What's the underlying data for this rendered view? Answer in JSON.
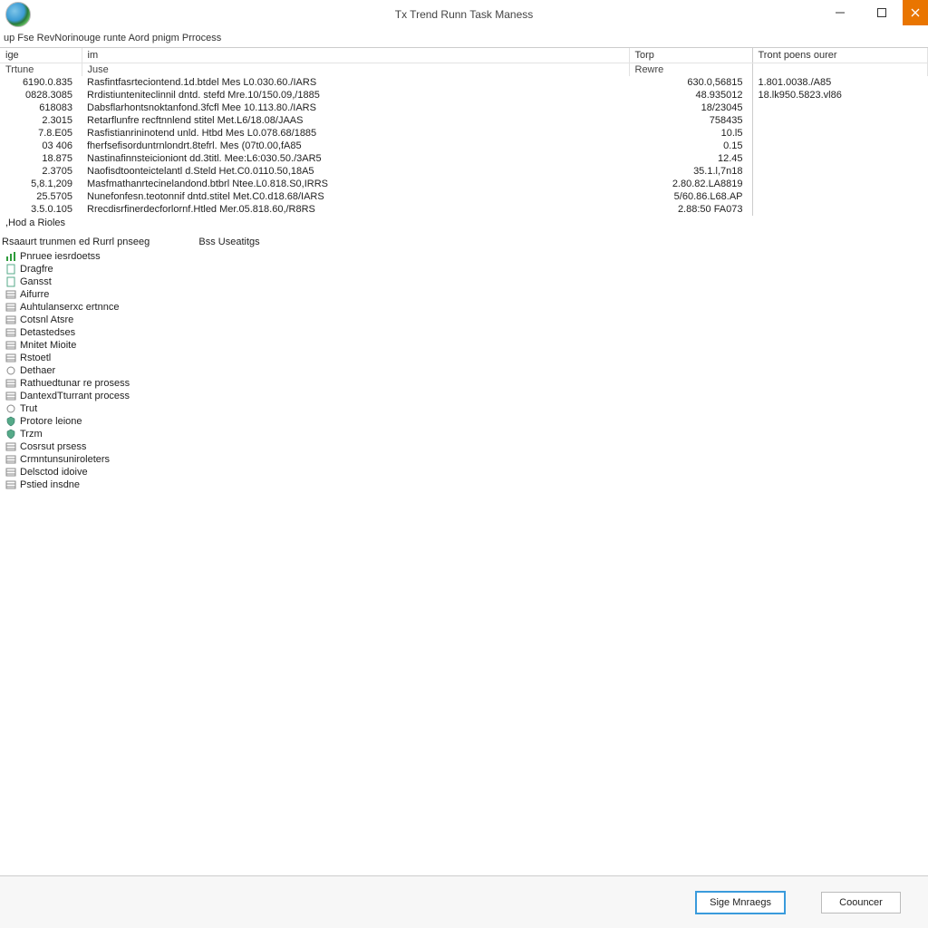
{
  "window": {
    "title": "Tx Trend Runn Task Maness"
  },
  "menubar": "up  Fse RevNorinouge runte Aord pnigm Prrocess",
  "columns": {
    "c0": "ige",
    "c1": "im",
    "c2": "Torp",
    "c3": "Tront poens ourer",
    "s0": "Trtune",
    "s1": "Juse",
    "s2": "Rewre"
  },
  "rows": [
    {
      "a": "6190.0.835",
      "b": "Rasfintfasrteciontend.1d.btdel Mes L0.030.60./IARS",
      "c": "630.0,56815",
      "d": "1.801.0038./A85"
    },
    {
      "a": "0828.3085",
      "b": "Rrdistiunteniteclinnil dntd. stefd Mre.10/150.09,/1885",
      "c": "48.935012",
      "d": "18.lk950.5823.vl86"
    },
    {
      "a": "618083",
      "b": "Dabsflarhontsnoktanfond.3fcfl Mee 10.113.80./IARS",
      "c": "18/23045",
      "d": ""
    },
    {
      "a": "2.3015",
      "b": "Retarflunfre recftnnlend stitel Met.L6/18.08/JAAS",
      "c": "758435",
      "d": ""
    },
    {
      "a": "7.8.E05",
      "b": "Rasfistianrininotend unld. Htbd Mes L0.078.68/1885",
      "c": "10.l5",
      "d": ""
    },
    {
      "a": "03 406",
      "b": "fherfsefisorduntrnlondrt.8tefrl. Mes (07t0.00,fA85",
      "c": "0.15",
      "d": ""
    },
    {
      "a": "18.875",
      "b": "Nastinafinnsteicioniont dd.3titl. Mee:L6:030.50./3AR5",
      "c": "12.45",
      "d": ""
    },
    {
      "a": "2.3705",
      "b": "Naofisdtoonteictelantl d.Steld Het.C0.0110.50,18A5",
      "c": "35.1.l,7n18",
      "d": ""
    },
    {
      "a": "5,8.1,209",
      "b": "Masfmathanrtecinelandond.btbrl Ntee.L0.818.S0,IRRS",
      "c": "2.80.82.LA8819",
      "d": ""
    },
    {
      "a": "25.5705",
      "b": "Nunefonfesn.teotonnif dntd.stitel Met.C0.d18.68/IARS",
      "c": "5/60.86.L68.AP",
      "d": ""
    },
    {
      "a": "3.5.0.105",
      "b": "Rrecdisrfinerdecforlornf.Htled Mer.05.818.60,/R8RS",
      "c": "2.88:50 FA073",
      "d": ""
    }
  ],
  "had": ",Hod a Rioles",
  "lower_head": {
    "left": "Rsaaurt trunmen ed Rurrl pnseeg",
    "right": "Bss Useatitgs"
  },
  "tree": [
    {
      "icon": "chart",
      "label": "Pnruee iesrdoetss"
    },
    {
      "icon": "page",
      "label": "Dragfre"
    },
    {
      "icon": "page",
      "label": "Gansst"
    },
    {
      "icon": "list",
      "label": "Aifurre"
    },
    {
      "icon": "list",
      "label": "Auhtulanserxc ertnnce"
    },
    {
      "icon": "list",
      "label": "Cotsnl Atsre"
    },
    {
      "icon": "list",
      "label": "Detastedses"
    },
    {
      "icon": "list",
      "label": "Mnitet Mioite"
    },
    {
      "icon": "list",
      "label": "Rstoetl"
    },
    {
      "icon": "circle",
      "label": "Dethaer"
    },
    {
      "icon": "list",
      "label": "Rathuedtunar re prosess"
    },
    {
      "icon": "list",
      "label": "DantexdTturrant process"
    },
    {
      "icon": "circle",
      "label": "Trut"
    },
    {
      "icon": "shield",
      "label": "Protore leione"
    },
    {
      "icon": "shield",
      "label": "Trzm"
    },
    {
      "icon": "list",
      "label": "Cosrsut prsess"
    },
    {
      "icon": "list",
      "label": "Crmntunsuniroleters"
    },
    {
      "icon": "list",
      "label": "Delsctod idoive"
    },
    {
      "icon": "list",
      "label": "Pstied insdne"
    }
  ],
  "footer": {
    "primary": "Sige Mnraegs",
    "secondary": "Coouncer"
  }
}
